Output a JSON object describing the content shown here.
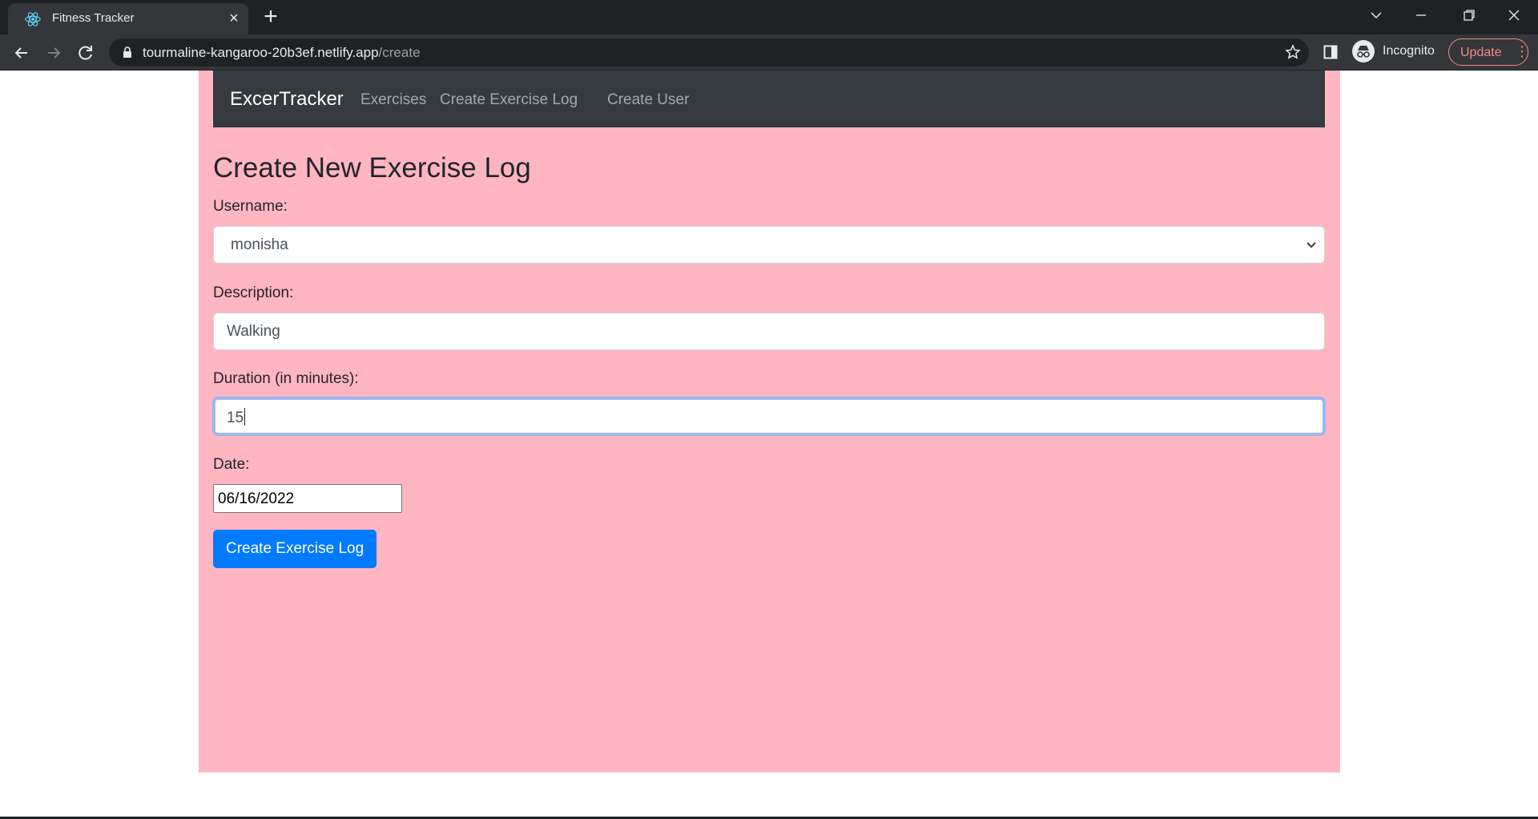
{
  "browser": {
    "tab_title": "Fitness Tracker",
    "url_host": "tourmaline-kangaroo-20b3ef.netlify.app",
    "url_path": "/create",
    "incognito_label": "Incognito",
    "update_label": "Update"
  },
  "navbar": {
    "brand": "ExcerTracker",
    "links": [
      "Exercises",
      "Create Exercise Log",
      "Create User"
    ]
  },
  "form": {
    "heading": "Create New Exercise Log",
    "username_label": "Username:",
    "username_value": "monisha",
    "description_label": "Description:",
    "description_value": "Walking",
    "duration_label": "Duration (in minutes):",
    "duration_value": "15",
    "date_label": "Date:",
    "date_value": "06/16/2022",
    "submit_label": "Create Exercise Log"
  },
  "colors": {
    "page_background": "#ffb6c1",
    "navbar_background": "#343a40",
    "button_primary": "#007bff"
  }
}
